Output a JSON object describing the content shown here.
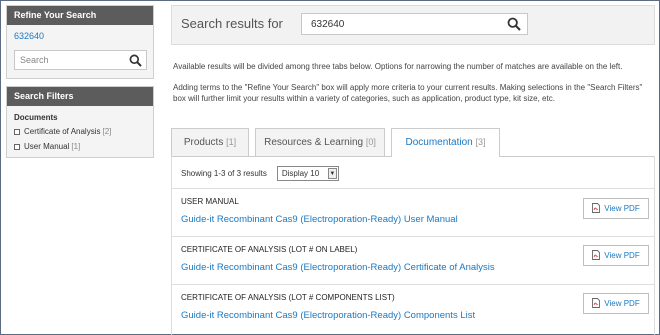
{
  "sidebar": {
    "refine": {
      "title": "Refine Your Search",
      "term": "632640",
      "search_placeholder": "Search"
    },
    "filters": {
      "title": "Search Filters",
      "group_title": "Documents",
      "items": [
        {
          "label": "Certificate of Analysis",
          "count": "[2]"
        },
        {
          "label": "User Manual",
          "count": "[1]"
        }
      ]
    }
  },
  "header": {
    "label": "Search results for",
    "query": "632640"
  },
  "info": {
    "line1": "Available results will be divided among three tabs below. Options for narrowing the number of matches are available on the left.",
    "line2": "Adding terms to the \"Refine Your Search\" box will apply more criteria to your current results. Making selections in the \"Search Filters\" box will further limit your results within a variety of categories, such as application, product type, kit size, etc."
  },
  "tabs": [
    {
      "label": "Products",
      "count": "[1]"
    },
    {
      "label": "Resources & Learning",
      "count": "[0]"
    },
    {
      "label": "Documentation",
      "count": "[3]"
    }
  ],
  "results": {
    "showing": "Showing 1-3 of 3 results",
    "display_value": "Display 10",
    "pdf_label": "View PDF",
    "items": [
      {
        "type": "USER MANUAL",
        "title": "Guide-it Recombinant Cas9 (Electroporation-Ready) User Manual"
      },
      {
        "type": "CERTIFICATE OF ANALYSIS (LOT # ON LABEL)",
        "title": "Guide-it Recombinant Cas9 (Electroporation-Ready) Certificate of Analysis"
      },
      {
        "type": "CERTIFICATE OF ANALYSIS (LOT # COMPONENTS LIST)",
        "title": "Guide-it Recombinant Cas9 (Electroporation-Ready) Components List"
      }
    ]
  },
  "colors": {
    "accent": "#1a78c2",
    "panel_header": "#5c5c5c"
  },
  "icons": [
    "search-icon",
    "checkbox-icon",
    "pdf-icon",
    "dropdown-arrow-icon"
  ]
}
